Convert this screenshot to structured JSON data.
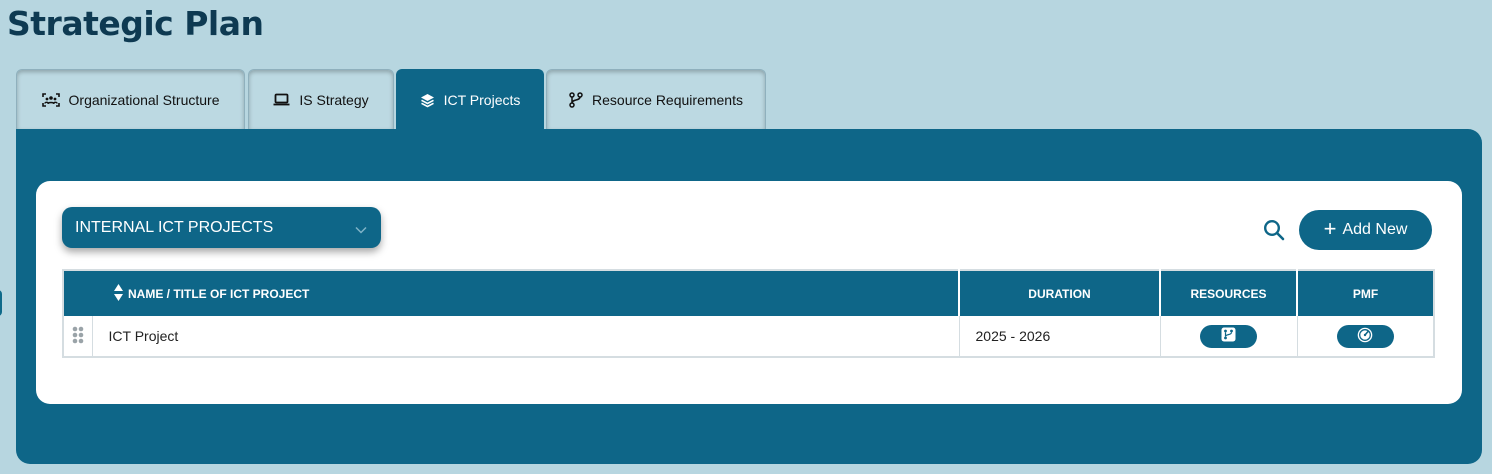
{
  "page": {
    "title": "Strategic Plan"
  },
  "tabs": [
    {
      "label": "Organizational Structure",
      "icon": "org-structure-icon",
      "active": false
    },
    {
      "label": "IS Strategy",
      "icon": "laptop-icon",
      "active": false
    },
    {
      "label": "ICT Projects",
      "icon": "layers-icon",
      "active": true
    },
    {
      "label": "Resource Requirements",
      "icon": "branch-icon",
      "active": false
    }
  ],
  "toolbar": {
    "project_type_selected": "INTERNAL ICT PROJECTS",
    "add_label": "Add New",
    "search_icon": "search-icon"
  },
  "table": {
    "columns": [
      "NAME / TITLE OF ICT PROJECT",
      "DURATION",
      "RESOURCES",
      "PMF"
    ],
    "rows": [
      {
        "name": "ICT Project",
        "duration": "2025 - 2026"
      }
    ]
  },
  "colors": {
    "primary": "#0e6688",
    "background": "#b7d6e0",
    "title": "#0e3a52"
  }
}
